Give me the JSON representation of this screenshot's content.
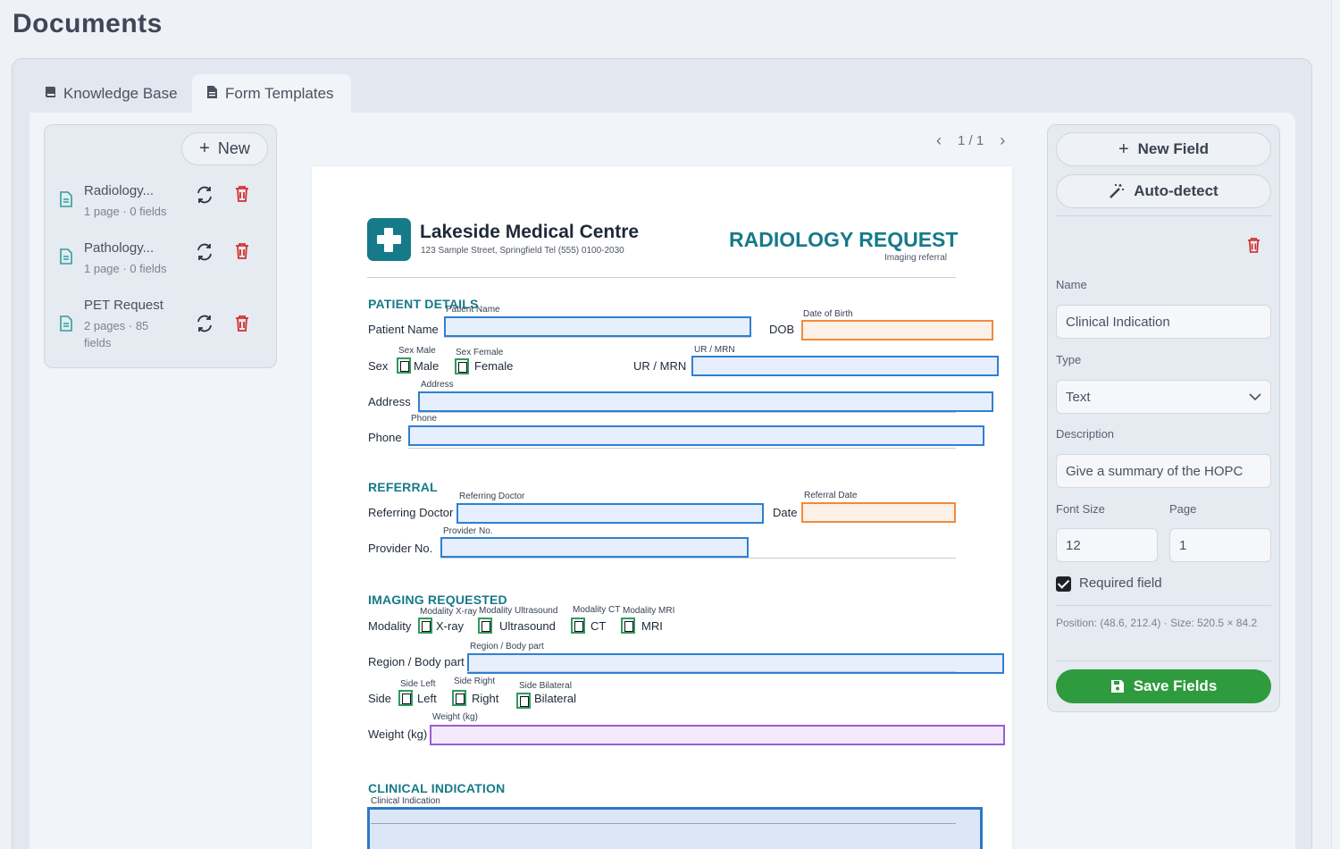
{
  "page_title": "Documents",
  "tabs": [
    {
      "label": "Knowledge Base",
      "icon": "book-icon"
    },
    {
      "label": "Form Templates",
      "icon": "document-icon"
    }
  ],
  "doc_list": {
    "new_label": "New",
    "items": [
      {
        "name": "Radiology...",
        "meta": "1 page · 0 fields"
      },
      {
        "name": "Pathology...",
        "meta": "1 page · 0 fields"
      },
      {
        "name": "PET Request",
        "meta": "2 pages · 85 fields"
      }
    ]
  },
  "pager": {
    "text": "1 / 1"
  },
  "form": {
    "clinic_name": "Lakeside Medical Centre",
    "clinic_address": "123 Sample Street, Springfield   Tel (555) 0100-2030",
    "form_title": "RADIOLOGY REQUEST",
    "form_subtitle": "Imaging referral",
    "sections": {
      "patient": "PATIENT DETAILS",
      "referral": "REFERRAL",
      "imaging": "IMAGING REQUESTED",
      "clinical": "CLINICAL INDICATION"
    },
    "labels": {
      "patient_name": "Patient Name",
      "dob": "DOB",
      "sex": "Sex",
      "male": "Male",
      "female": "Female",
      "ur_mrn": "UR / MRN",
      "address": "Address",
      "phone": "Phone",
      "referring_doctor": "Referring Doctor",
      "date": "Date",
      "provider_no": "Provider No.",
      "modality": "Modality",
      "xray": "X-ray",
      "ultrasound": "Ultrasound",
      "ct": "CT",
      "mri": "MRI",
      "region": "Region / Body part",
      "side": "Side",
      "left": "Left",
      "right": "Right",
      "bilateral": "Bilateral",
      "weight": "Weight (kg)"
    },
    "field_tags": {
      "patient_name": "Patient Name",
      "dob": "Date of Birth",
      "sex_male": "Sex Male",
      "sex_female": "Sex Female",
      "ur_mrn": "UR / MRN",
      "address": "Address",
      "phone": "Phone",
      "referring_doctor": "Referring Doctor",
      "referral_date": "Referral Date",
      "provider_no": "Provider No.",
      "modality_xray": "Modality X-ray",
      "modality_ultrasound": "Modality Ultrasound",
      "modality_ct": "Modality CT",
      "modality_mri": "Modality MRI",
      "region": "Region / Body part",
      "side_left": "Side Left",
      "side_right": "Side Right",
      "side_bilateral": "Side Bilateral",
      "weight": "Weight (kg)",
      "clinical_indication": "Clinical Indication"
    }
  },
  "props": {
    "new_field_label": "New Field",
    "auto_detect_label": "Auto-detect",
    "name_label": "Name",
    "name_value": "Clinical Indication",
    "type_label": "Type",
    "type_value": "Text",
    "description_label": "Description",
    "description_value": "Give a summary of the HOPC",
    "font_size_label": "Font Size",
    "font_size_value": "12",
    "page_label": "Page",
    "page_value": "1",
    "required_label": "Required field",
    "position_text": "Position: (48.6, 212.4) · Size: 520.5 × 84.2",
    "save_label": "Save Fields"
  },
  "colors": {
    "accent_teal": "#167a8a",
    "text_field_border": "#2f7fd3",
    "date_field_border": "#ef8a3c",
    "number_field_border": "#9a5bd6",
    "checkbox_border": "#2f9a5f",
    "delete_red": "#d32f2f",
    "save_green": "#2e9b3e"
  }
}
